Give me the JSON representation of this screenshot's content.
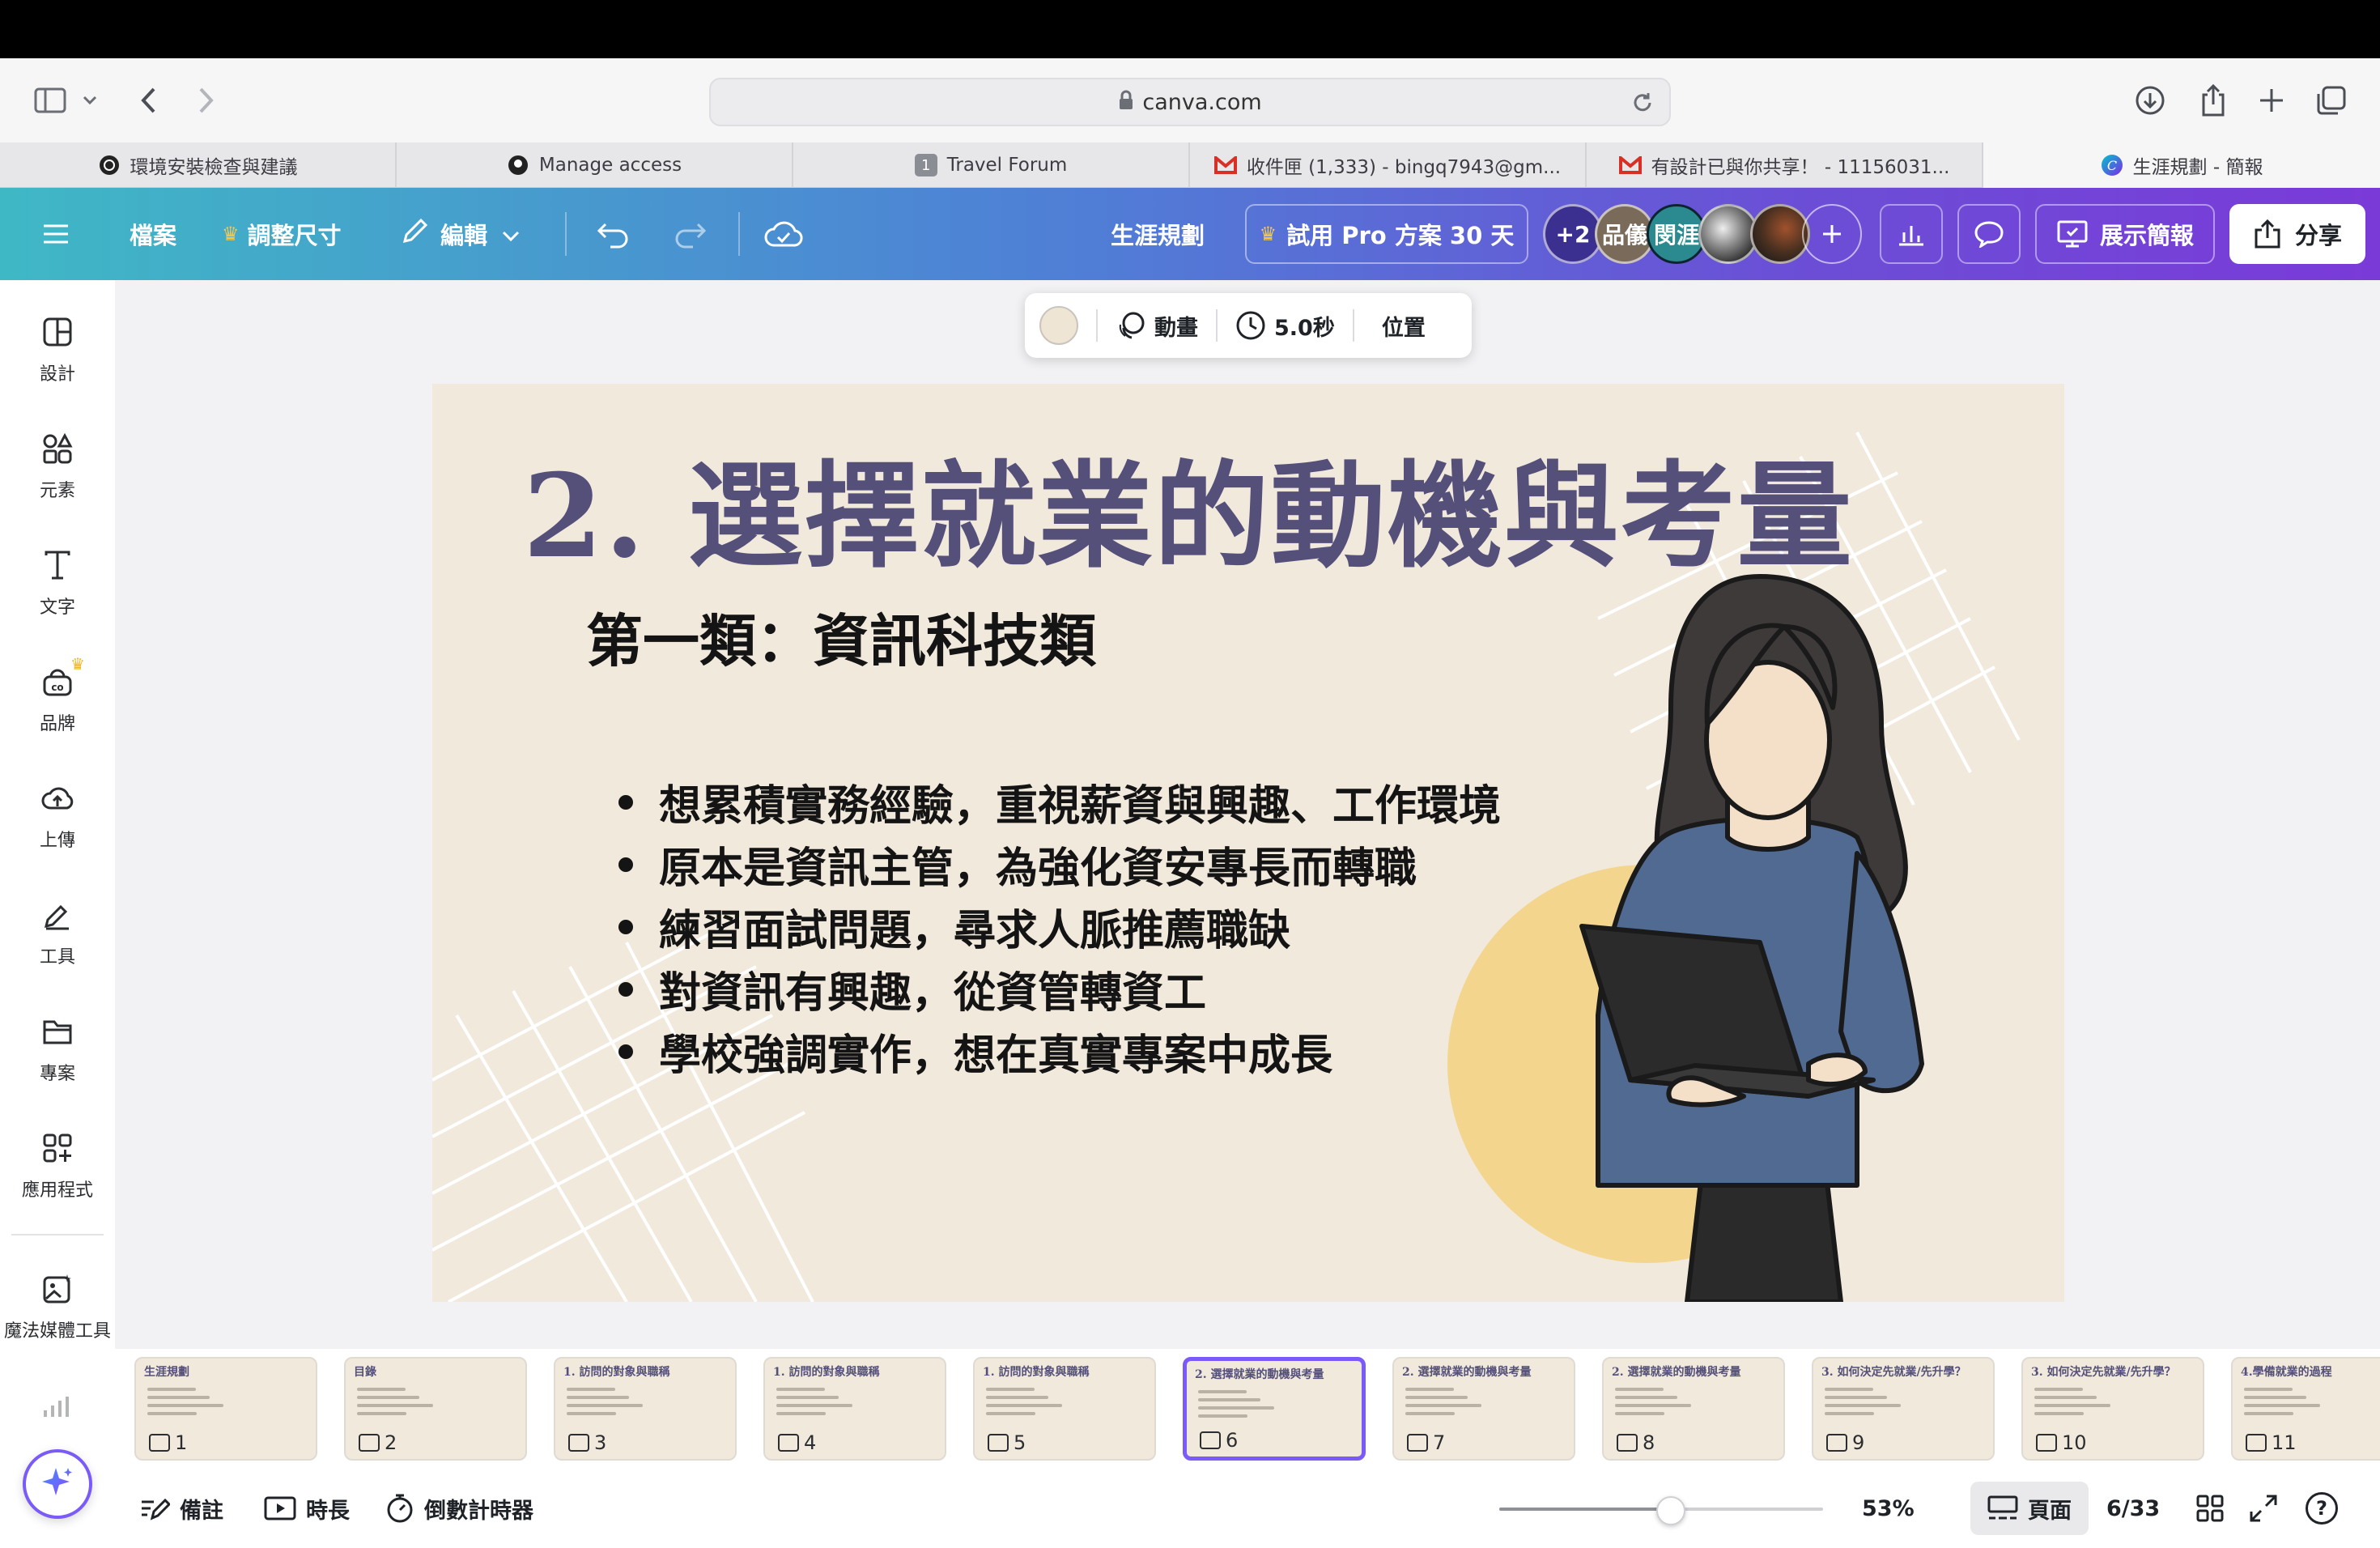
{
  "browser": {
    "url": "canva.com",
    "tabs": [
      {
        "label": "環境安裝檢查與建議",
        "icon": "openai-icon"
      },
      {
        "label": "Manage access",
        "icon": "github-icon"
      },
      {
        "label": "Travel Forum",
        "icon": "tab-number-icon",
        "badge": "1"
      },
      {
        "label": "收件匣 (1,333) - bingq7943@gm...",
        "icon": "gmail-icon"
      },
      {
        "label": "有設計已與你共享！ - 11156031...",
        "icon": "gmail-icon"
      },
      {
        "label": "生涯規劃 - 簡報",
        "icon": "canva-icon"
      }
    ]
  },
  "header": {
    "menu_icon": "menu-icon",
    "file": "檔案",
    "resize": "調整尺寸",
    "edit": "編輯",
    "doc_title": "生涯規劃",
    "pro_trial": "試用 Pro 方案 30 天",
    "collaborators_more": "+2",
    "avatars": [
      "品儀",
      "閔涯"
    ],
    "present": "展示簡報",
    "share": "分享"
  },
  "sidebar": {
    "items": [
      {
        "label": "設計",
        "icon": "design-icon"
      },
      {
        "label": "元素",
        "icon": "elements-icon"
      },
      {
        "label": "文字",
        "icon": "text-icon"
      },
      {
        "label": "品牌",
        "icon": "brand-icon"
      },
      {
        "label": "上傳",
        "icon": "upload-icon"
      },
      {
        "label": "工具",
        "icon": "tools-icon"
      },
      {
        "label": "專案",
        "icon": "projects-icon"
      },
      {
        "label": "應用程式",
        "icon": "apps-icon"
      },
      {
        "label": "魔法媒體工具",
        "icon": "magic-media-icon"
      }
    ]
  },
  "float_toolbar": {
    "animate": "動畫",
    "duration": "5.0秒",
    "position": "位置",
    "color": "#efe5d5"
  },
  "slide": {
    "title": "2. 選擇就業的動機與考量",
    "subtitle": "第一類：資訊科技類",
    "bullets": [
      "想累積實務經驗，重視薪資與興趣、工作環境",
      "原本是資訊主管，為強化資安專長而轉職",
      "練習面試問題，尋求人脈推薦職缺",
      "對資訊有興趣，從資管轉資工",
      "學校強調實作，想在真實專案中成長"
    ]
  },
  "filmstrip": {
    "thumbs": [
      {
        "num": "1",
        "title": "生涯規劃"
      },
      {
        "num": "2",
        "title": "目錄"
      },
      {
        "num": "3",
        "title": "1. 訪問的對象與職稱"
      },
      {
        "num": "4",
        "title": "1. 訪問的對象與職稱"
      },
      {
        "num": "5",
        "title": "1. 訪問的對象與職稱"
      },
      {
        "num": "6",
        "title": "2. 選擇就業的動機與考量"
      },
      {
        "num": "7",
        "title": "2. 選擇就業的動機與考量"
      },
      {
        "num": "8",
        "title": "2. 選擇就業的動機與考量"
      },
      {
        "num": "9",
        "title": "3. 如何決定先就業/先升學？"
      },
      {
        "num": "10",
        "title": "3. 如何決定先就業/先升學？"
      },
      {
        "num": "11",
        "title": "4.學備就業的過程"
      }
    ],
    "active_index": 5
  },
  "bottom": {
    "notes": "備註",
    "duration": "時長",
    "timer": "倒數計時器",
    "zoom": "53%",
    "zoom_fraction": 0.53,
    "page_view": "頁面",
    "page_count": "6/33",
    "help": "?"
  },
  "colors": {
    "accent": "#7a5af8",
    "slide_bg": "#f1e9dc",
    "slide_title": "#54507a",
    "circle": "#f3d58d"
  }
}
